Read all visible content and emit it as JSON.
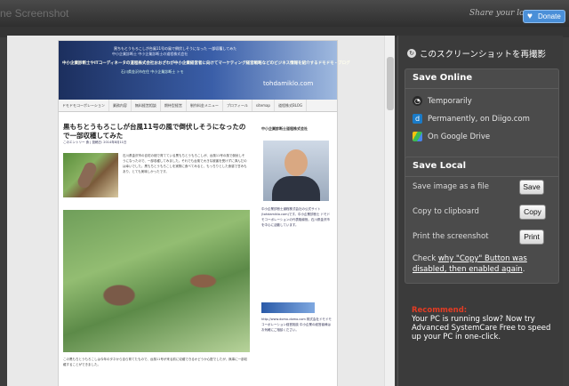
{
  "window": {
    "title": "ne Screenshot"
  },
  "topbar": {
    "share_text": "Share your love",
    "donate_label": "Donate"
  },
  "preview": {
    "banner": {
      "line1": "黒ちもとうもろこしが台風11号の風で倒伏しそうになった 一部収穫してみた",
      "line2": "中小企業診断士 中小企業診断士の道程株式会社",
      "line3": "中小企業診断士やITコーディネータの道程株式会社おおざわが中小企業経営者に向けてマーケティング経営戦略などのビジネス情報を紹介するドモドモ・ブログ",
      "line4": "石川県金沢市在住 中小企業診断士 トモ",
      "logo": "tohdamiklo.com"
    },
    "nav": [
      "ドモドモコーポレーション",
      "業務内容",
      "無料経営相談",
      "期待型経営",
      "制作料金メニュー",
      "プロフィール",
      "sitemap",
      "道程株式BLOG"
    ],
    "article_title": "黒もちとうもろこしが台風11号の風で倒伏しそうになったので一部収穫してみた",
    "meta": "このエントリー 食 | 投稿日: 2014年8月11日",
    "paragraph": "石川県金沢市の自宅の畑で育てている黒もちとうもろこしが、台風11号の風で倒伏しそうになったので、一部収穫してみました。それでも台風で大きな被害を受けずに済んだのは幸いでした。黒もちとうもろこしを実際に食べてみると、もっちりとした食感で甘みもあり、とても美味しかったです。",
    "caption": "この黒もちとうもろこしは今年のタネから自ら育てたもので、台風11号が来る前に収穫できるかどうか心配でしたが、無事に一部収穫することができました。",
    "sidebar_title": "中小企業診断士道程株式会社",
    "sidebar_text": "中小企業診断士道程株式会社の公式サイト(tohdamiklo.com)です。中小企業診断士 ドモドモコーポレーションの代表取締役。石川県金沢市を中心に活動しています。",
    "sidebar_text2": "http://www.domo-domo.com 株式会社ドモドモコーポレーション経営相談 中小企業の経営者様はお気軽にご相談ください。"
  },
  "panel": {
    "recapture_label": "このスクリーンショットを再撮影",
    "save_online": {
      "heading": "Save Online",
      "items": [
        {
          "label": "Temporarily",
          "icon": "clock-icon"
        },
        {
          "label": "Permanently, on Diigo.com",
          "icon": "diigo-icon"
        },
        {
          "label": "On Google Drive",
          "icon": "google-drive-icon"
        }
      ]
    },
    "save_local": {
      "heading": "Save Local",
      "rows": [
        {
          "label": "Save image as a file",
          "button": "Save"
        },
        {
          "label": "Copy to clipboard",
          "button": "Copy"
        },
        {
          "label": "Print the screenshot",
          "button": "Print"
        }
      ],
      "check_prefix": "Check ",
      "check_link": "why \"Copy\" Button was disabled, then enabled again",
      "check_suffix": "."
    },
    "promo": {
      "headline": "Recommend:",
      "body": "Your PC is running slow? Now try Advanced SystemCare Free to speed up your PC in one-click."
    }
  },
  "colors": {
    "donate": "#4a8fd8",
    "promo_red": "#e23c24",
    "panel_bg": "#3b3b3b"
  }
}
